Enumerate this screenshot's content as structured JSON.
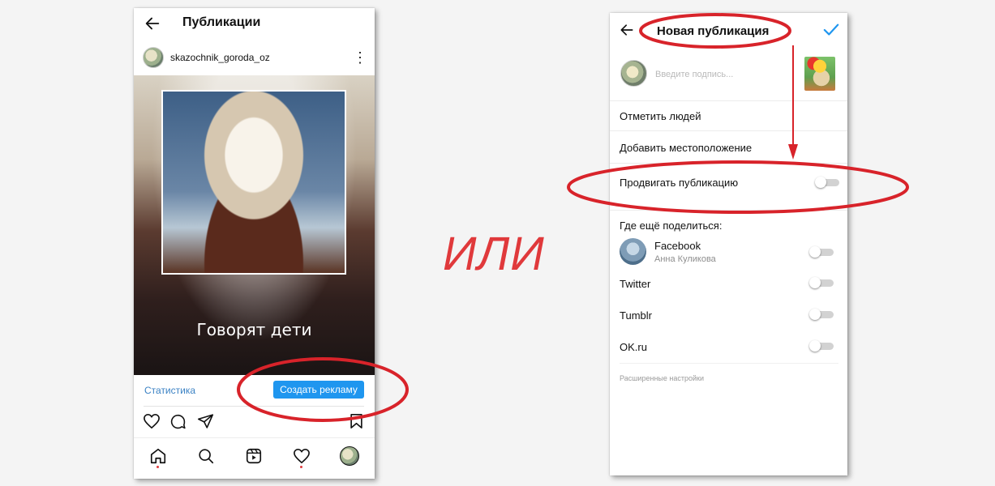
{
  "left_phone": {
    "header": {
      "title": "Публикации",
      "back_icon": "arrow-left-icon"
    },
    "post": {
      "username": "skazochnik_goroda_oz",
      "more_icon": "more-vertical-icon",
      "caption_overlay": "Говорят дети"
    },
    "actions_bar": {
      "stats_label": "Статистика",
      "create_ad_label": "Создать рекламу"
    },
    "post_actions": {
      "like_icon": "heart-icon",
      "comment_icon": "comment-icon",
      "share_icon": "paper-plane-icon",
      "save_icon": "bookmark-icon"
    },
    "bottom_nav": [
      "home-icon",
      "search-icon",
      "reels-icon",
      "heart-icon",
      "profile-avatar"
    ]
  },
  "separator_text": "ИЛИ",
  "right_phone": {
    "header": {
      "title": "Новая публикация",
      "back_icon": "arrow-left-icon",
      "confirm_icon": "check-icon"
    },
    "caption_placeholder": "Введите подпись...",
    "menu": [
      {
        "label": "Отметить людей"
      },
      {
        "label": "Добавить местоположение"
      },
      {
        "label": "Продвигать публикацию",
        "toggle": false
      }
    ],
    "share_section": {
      "title": "Где ещё поделиться:",
      "items": [
        {
          "label": "Facebook",
          "sublabel": "Анна Куликова",
          "enabled": false
        },
        {
          "label": "Twitter",
          "enabled": false
        },
        {
          "label": "Tumblr",
          "enabled": false
        },
        {
          "label": "OK.ru",
          "enabled": false
        }
      ]
    },
    "advanced_label": "Расширенные настройки"
  },
  "colors": {
    "highlight": "#d8232a",
    "accent_blue": "#1f96ef",
    "link_blue": "#3b82c4",
    "ili_red": "#e0393b"
  }
}
